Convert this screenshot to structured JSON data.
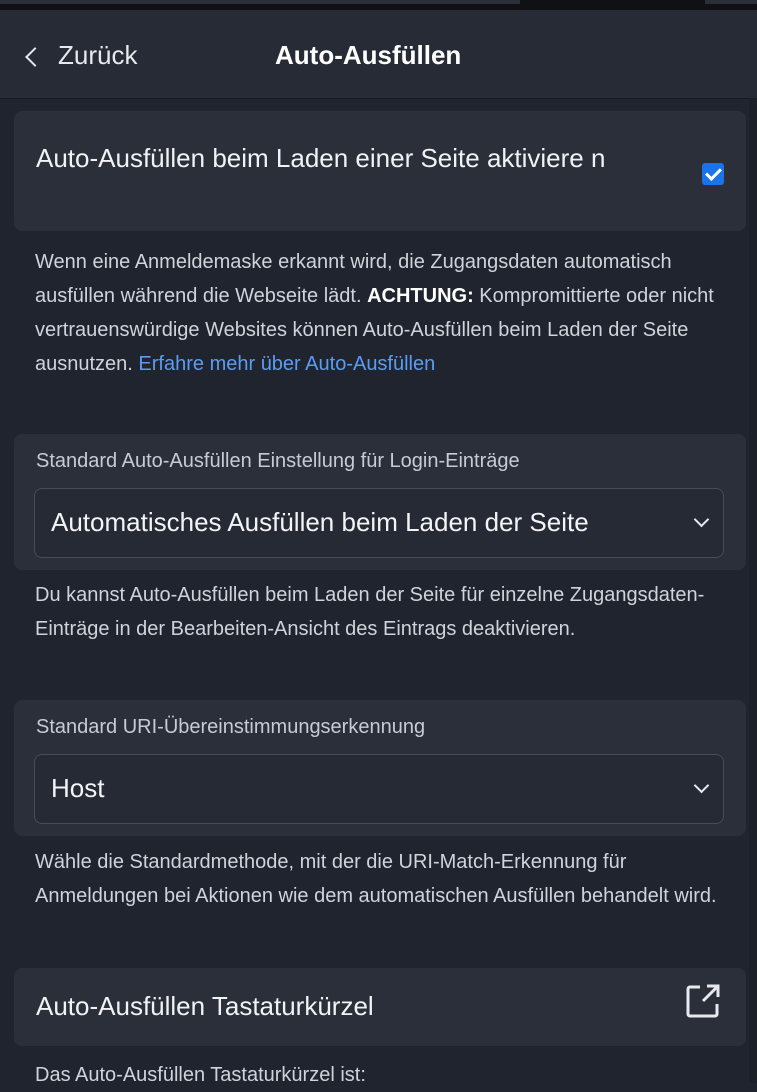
{
  "header": {
    "back_label": "Zurück",
    "title": "Auto-Ausfüllen"
  },
  "autofill_on_load": {
    "label": "Auto-Ausfüllen beim Laden einer Seite aktiviere n",
    "checked": true,
    "help_text": "Wenn eine Anmeldemaske erkannt wird, die Zugangsdaten automatisch ausfüllen während die Webseite lädt.",
    "warning_bold": "ACHTUNG:",
    "warning_text": " Kompromittierte oder nicht vertrauenswürdige Websites können Auto-Ausfüllen beim Laden der Seite ausnutzen.",
    "learn_more": "Erfahre mehr über Auto-Ausfüllen"
  },
  "default_autofill_setting": {
    "label": "Standard Auto-Ausfüllen Einstellung für Login-Einträge",
    "selected": "Automatisches Ausfüllen beim Laden der Seite",
    "help_text": "Du kannst Auto-Ausfüllen beim Laden der Seite für einzelne Zugangsdaten-Einträge in der Bearbeiten-Ansicht des Eintrags deaktivieren."
  },
  "default_uri_match": {
    "label": "Standard URI-Übereinstimmungserkennung",
    "selected": "Host",
    "help_text": "Wähle die Standardmethode, mit der die URI-Match-Erkennung für Anmeldungen bei Aktionen wie dem automatischen Ausfüllen behandelt wird."
  },
  "shortcut": {
    "label": "Auto-Ausfüllen Tastaturkürzel",
    "icon": "external-link-icon",
    "help_text": "Das Auto-Ausfüllen Tastaturkürzel ist:"
  },
  "colors": {
    "background": "#1f242e",
    "card": "#2a2f39",
    "link": "#5b9cf2",
    "checkbox": "#1a73e8"
  }
}
